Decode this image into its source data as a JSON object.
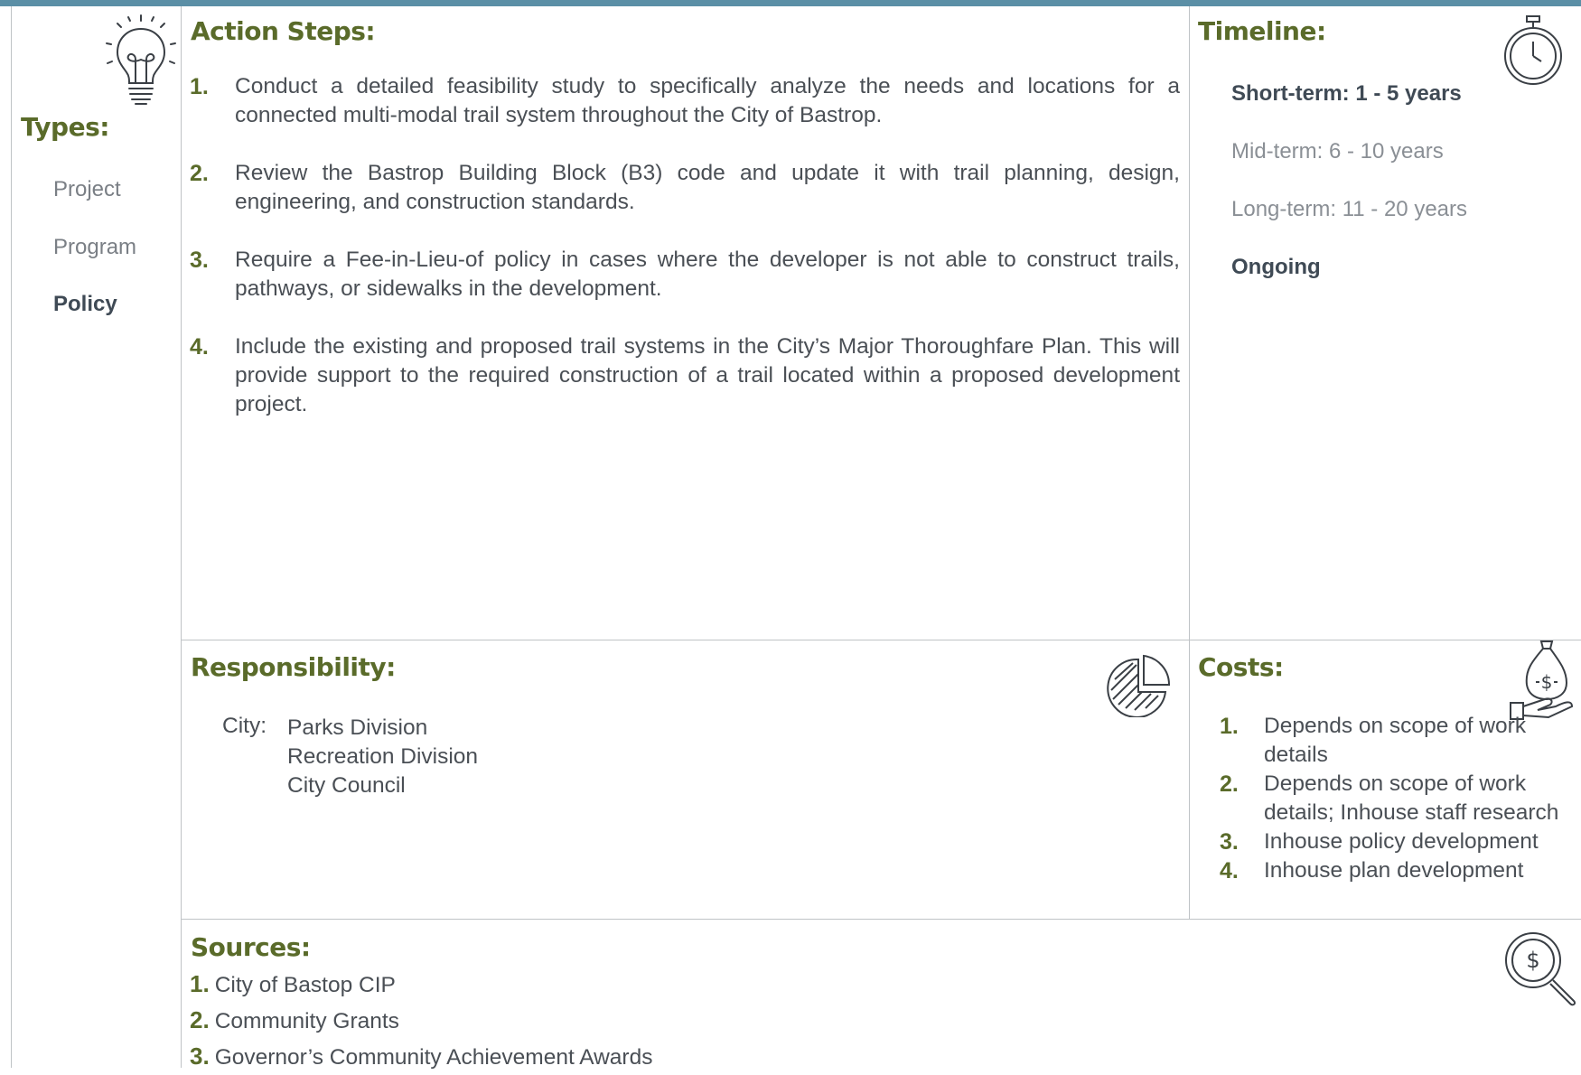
{
  "types": {
    "heading": "Types:",
    "items": [
      "Project",
      "Program",
      "Policy"
    ],
    "active": "Policy"
  },
  "action_steps": {
    "heading": "Action Steps:",
    "items": [
      {
        "num": "1.",
        "text": "Conduct a detailed feasibility study to specifically analyze the needs and locations for a connected multi-modal trail system throughout the City of Bastrop."
      },
      {
        "num": "2.",
        "text": "Review the Bastrop Building Block (B3) code and update it with trail planning, design, engineering, and construction standards."
      },
      {
        "num": "3.",
        "text": "Require a Fee-in-Lieu-of policy in cases where the developer is not able to construct trails, pathways, or sidewalks in the development."
      },
      {
        "num": "4.",
        "text": "Include the existing and proposed trail systems in the City’s Major Thoroughfare Plan. This will provide support to the required construction of a trail located within a proposed development project."
      }
    ]
  },
  "timeline": {
    "heading": "Timeline:",
    "short": "Short-term:  1 - 5 years",
    "mid": "Mid-term:  6 - 10 years",
    "long": "Long-term:  11 - 20 years",
    "ongoing": "Ongoing"
  },
  "responsibility": {
    "heading": "Responsibility:",
    "label": "City:",
    "items": [
      "Parks Division",
      "Recreation Division",
      "City Council"
    ]
  },
  "costs": {
    "heading": "Costs:",
    "items": [
      {
        "num": "1.",
        "text": "Depends on scope of work details"
      },
      {
        "num": "2.",
        "text": "Depends on scope of work details; Inhouse staff research"
      },
      {
        "num": "3.",
        "text": "Inhouse policy development"
      },
      {
        "num": "4.",
        "text": "Inhouse plan development"
      }
    ]
  },
  "sources": {
    "heading": "Sources:",
    "items": [
      {
        "num": "1.",
        "text": "City of Bastop CIP"
      },
      {
        "num": "2.",
        "text": "Community Grants"
      },
      {
        "num": "3.",
        "text": "Governor’s Community Achievement Awards"
      }
    ]
  },
  "icons": {
    "types": "lightbulb-icon",
    "timeline": "stopwatch-icon",
    "responsibility": "pie-chart-icon",
    "costs": "money-bag-hand-icon",
    "sources": "magnifier-dollar-icon"
  },
  "colors": {
    "heading": "#5a6b2a",
    "topbar": "#5b8fa6",
    "text": "#4a4f55",
    "muted": "#8a8f95"
  }
}
